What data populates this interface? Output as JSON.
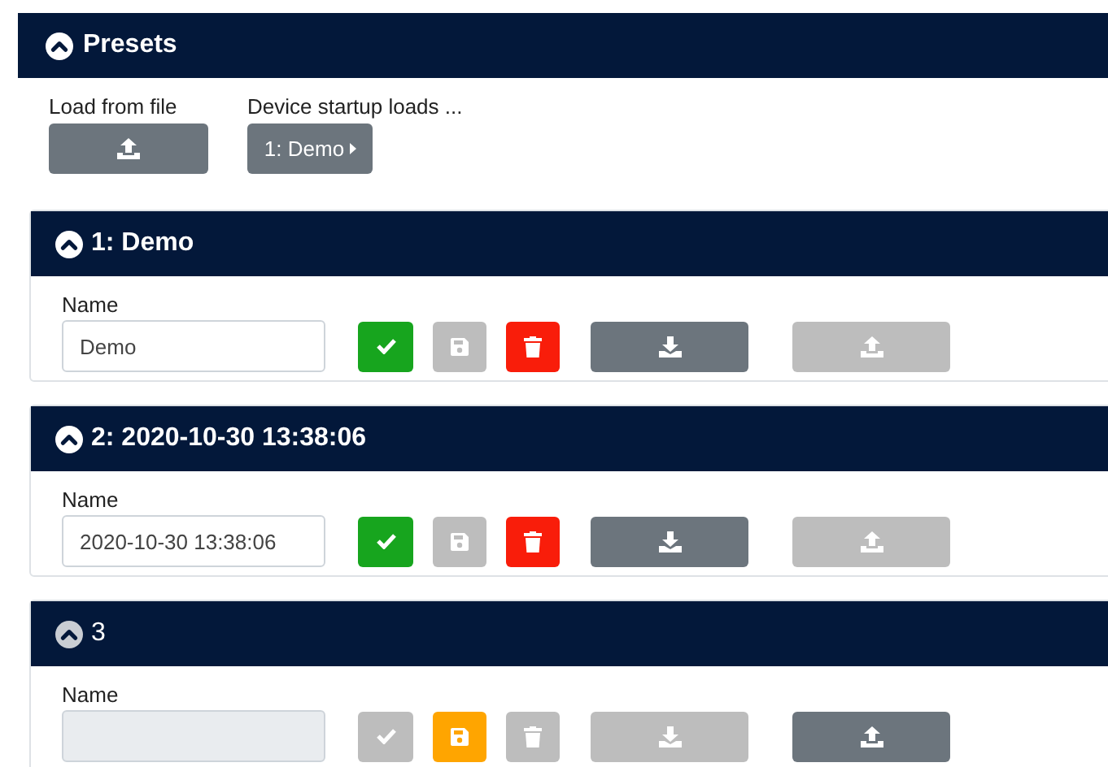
{
  "panel": {
    "title": "Presets",
    "expanded": true
  },
  "load_from_file": {
    "label": "Load from file"
  },
  "startup": {
    "label": "Device startup loads ...",
    "value": "1: Demo"
  },
  "presets": [
    {
      "title": "1: Demo",
      "saved": true,
      "expanded": true,
      "name_label": "Name",
      "name": "Demo",
      "name_disabled": false,
      "activate_enabled": true,
      "save_enabled": false,
      "delete_enabled": true,
      "download_enabled": true,
      "upload_enabled": false
    },
    {
      "title": "2: 2020-10-30 13:38:06",
      "saved": true,
      "expanded": true,
      "name_label": "Name",
      "name": "2020-10-30 13:38:06",
      "name_disabled": false,
      "activate_enabled": true,
      "save_enabled": false,
      "delete_enabled": true,
      "download_enabled": true,
      "upload_enabled": false
    },
    {
      "title": "3",
      "saved": false,
      "expanded": true,
      "name_label": "Name",
      "name_disabled": true,
      "activate_enabled": false,
      "save_enabled": true,
      "delete_enabled": false,
      "download_enabled": false,
      "upload_enabled": true
    }
  ]
}
